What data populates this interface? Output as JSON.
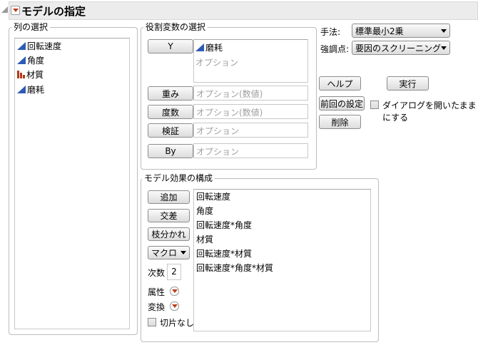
{
  "title": "モデルの指定",
  "columns": {
    "legend": "列の選択",
    "items": [
      {
        "label": "回転速度",
        "type": "continuous"
      },
      {
        "label": "角度",
        "type": "continuous"
      },
      {
        "label": "材質",
        "type": "nominal"
      },
      {
        "label": "磨耗",
        "type": "continuous"
      }
    ]
  },
  "roles": {
    "legend": "役割変数の選択",
    "y": {
      "button": "Y",
      "value": "磨耗",
      "placeholder": "オプション"
    },
    "weight": {
      "button": "重み",
      "placeholder": "オプション(数値)"
    },
    "freq": {
      "button": "度数",
      "placeholder": "オプション(数値)"
    },
    "validation": {
      "button": "検証",
      "placeholder": "オプション"
    },
    "by": {
      "button": "By",
      "placeholder": "オプション"
    }
  },
  "method": {
    "label": "手法:",
    "value": "標準最小2乗"
  },
  "emphasis": {
    "label": "強調点:",
    "value": "要因のスクリーニング"
  },
  "actions": {
    "help": "ヘルプ",
    "run": "実行",
    "recall": "前回の設定",
    "keep_open": "ダイアログを開いたままにする",
    "remove": "削除"
  },
  "effects": {
    "legend": "モデル効果の構成",
    "add": "追加",
    "cross": "交差",
    "nest": "枝分かれ",
    "macros": "マクロ",
    "degree_label": "次数",
    "degree": "2",
    "attributes": "属性",
    "transform": "変換",
    "no_intercept": "切片なし",
    "items": [
      "回転速度",
      "角度",
      "回転速度*角度",
      "材質",
      "回転速度*材質",
      "回転速度*角度*材質"
    ]
  }
}
